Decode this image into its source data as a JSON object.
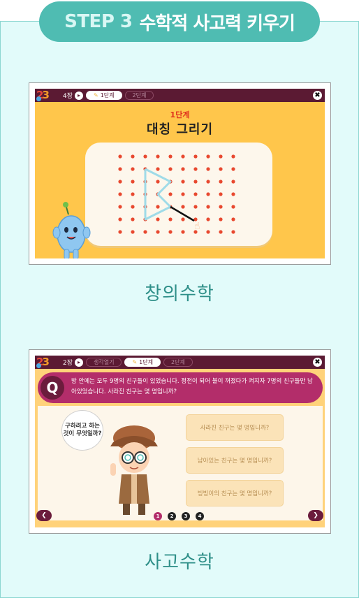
{
  "header": {
    "step_number": "STEP 3",
    "step_title": "수학적 사고력 키우기"
  },
  "screen1": {
    "chapter": "4장",
    "tabs": [
      {
        "label": "1단계",
        "active": true
      },
      {
        "label": "2단계",
        "active": false
      }
    ],
    "game_step": "1단계",
    "game_title": "대칭 그리기",
    "caption": "창의수학"
  },
  "screen2": {
    "chapter": "2장",
    "tabs": [
      {
        "label": "생각열기",
        "active": false
      },
      {
        "label": "1단계",
        "active": true
      },
      {
        "label": "2단계",
        "active": false
      }
    ],
    "question_badge": "Q",
    "question_text": "방 안에는 모두 9명의 친구들이 있었습니다. 정전이 되어 불이 꺼졌다가 켜지자 7명의 친구들만 남아있었습니다. 사라진 친구는 몇 명입니까?",
    "hint_bubble": "구하려고 하는 것이 무엇일까?",
    "answers": [
      "사라진 친구는 몇 명입니까?",
      "남아있는 친구는 몇 명입니까?",
      "빙빙이의 친구는 몇 명입니까?"
    ],
    "pages": [
      "1",
      "2",
      "3",
      "4"
    ],
    "current_page": 1,
    "caption": "사고수학"
  },
  "colors": {
    "teal": "#4fbcb2",
    "panel": "#e2fbfa",
    "maroon": "#5b1a33",
    "magenta": "#b32d6a",
    "yellow": "#ffc64b"
  },
  "icons": {
    "close": "close-icon",
    "next": "chevron-right-icon",
    "prev": "chevron-left-icon"
  }
}
